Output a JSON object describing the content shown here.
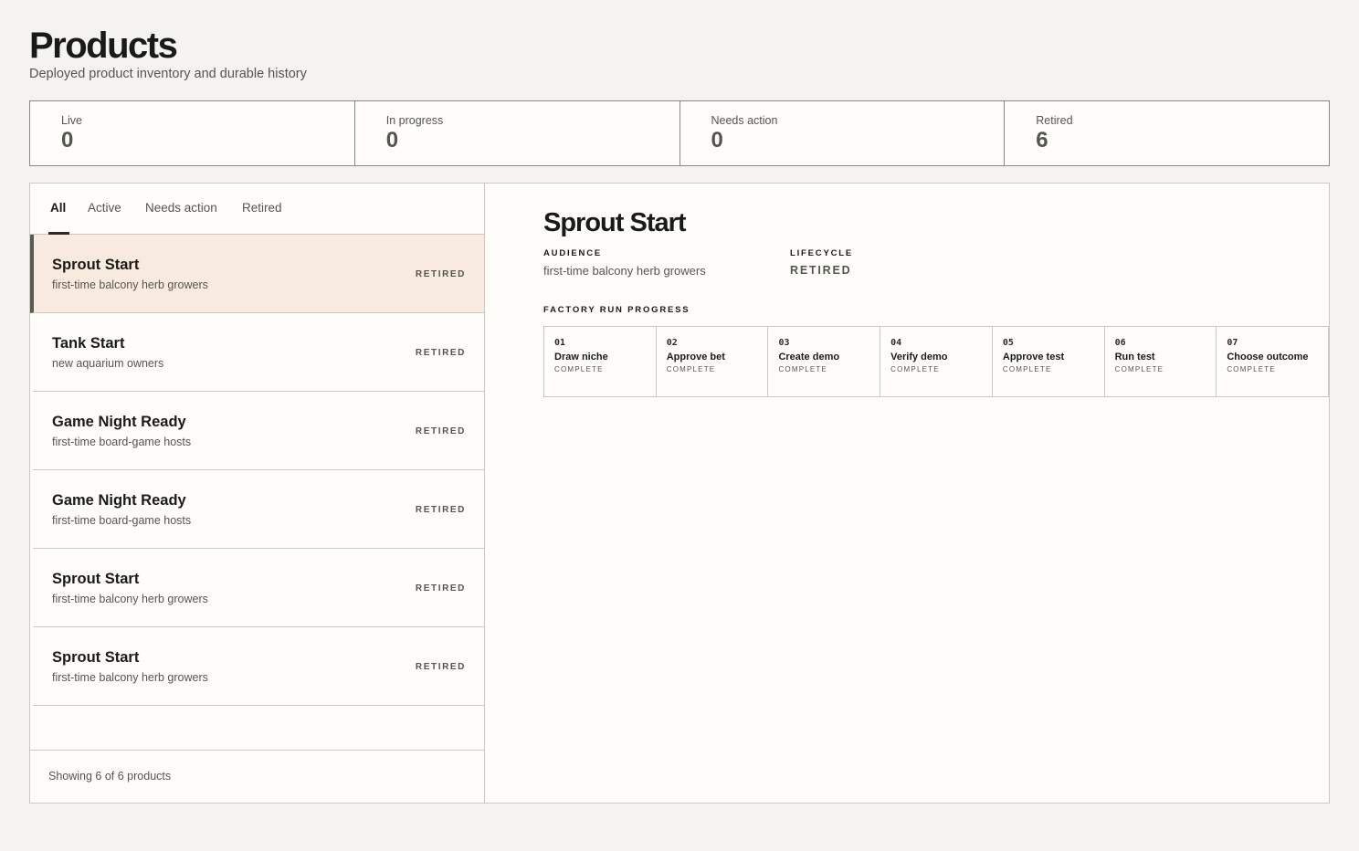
{
  "header": {
    "title": "Products",
    "subtitle": "Deployed product inventory and durable history"
  },
  "stats": [
    {
      "label": "Live",
      "value": "0"
    },
    {
      "label": "In progress",
      "value": "0"
    },
    {
      "label": "Needs action",
      "value": "0"
    },
    {
      "label": "Retired",
      "value": "6"
    }
  ],
  "tabs": [
    {
      "label": "All",
      "active": true
    },
    {
      "label": "Active",
      "active": false
    },
    {
      "label": "Needs action",
      "active": false
    },
    {
      "label": "Retired",
      "active": false
    }
  ],
  "products": [
    {
      "name": "Sprout Start",
      "audience": "first-time balcony herb growers",
      "status": "RETIRED",
      "selected": true
    },
    {
      "name": "Tank Start",
      "audience": "new aquarium owners",
      "status": "RETIRED",
      "selected": false
    },
    {
      "name": "Game Night Ready",
      "audience": "first-time board-game hosts",
      "status": "RETIRED",
      "selected": false
    },
    {
      "name": "Game Night Ready",
      "audience": "first-time board-game hosts",
      "status": "RETIRED",
      "selected": false
    },
    {
      "name": "Sprout Start",
      "audience": "first-time balcony herb growers",
      "status": "RETIRED",
      "selected": false
    },
    {
      "name": "Sprout Start",
      "audience": "first-time balcony herb growers",
      "status": "RETIRED",
      "selected": false
    }
  ],
  "list_footer": "Showing 6 of 6 products",
  "detail": {
    "title": "Sprout Start",
    "audience_label": "AUDIENCE",
    "audience_value": "first-time balcony herb growers",
    "lifecycle_label": "LIFECYCLE",
    "lifecycle_value": "RETIRED",
    "progress_label": "FACTORY RUN PROGRESS",
    "steps": [
      {
        "num": "01",
        "name": "Draw niche",
        "status": "COMPLETE"
      },
      {
        "num": "02",
        "name": "Approve bet",
        "status": "COMPLETE"
      },
      {
        "num": "03",
        "name": "Create demo",
        "status": "COMPLETE"
      },
      {
        "num": "04",
        "name": "Verify demo",
        "status": "COMPLETE"
      },
      {
        "num": "05",
        "name": "Approve test",
        "status": "COMPLETE"
      },
      {
        "num": "06",
        "name": "Run test",
        "status": "COMPLETE"
      },
      {
        "num": "07",
        "name": "Choose outcome",
        "status": "COMPLETE"
      }
    ]
  }
}
